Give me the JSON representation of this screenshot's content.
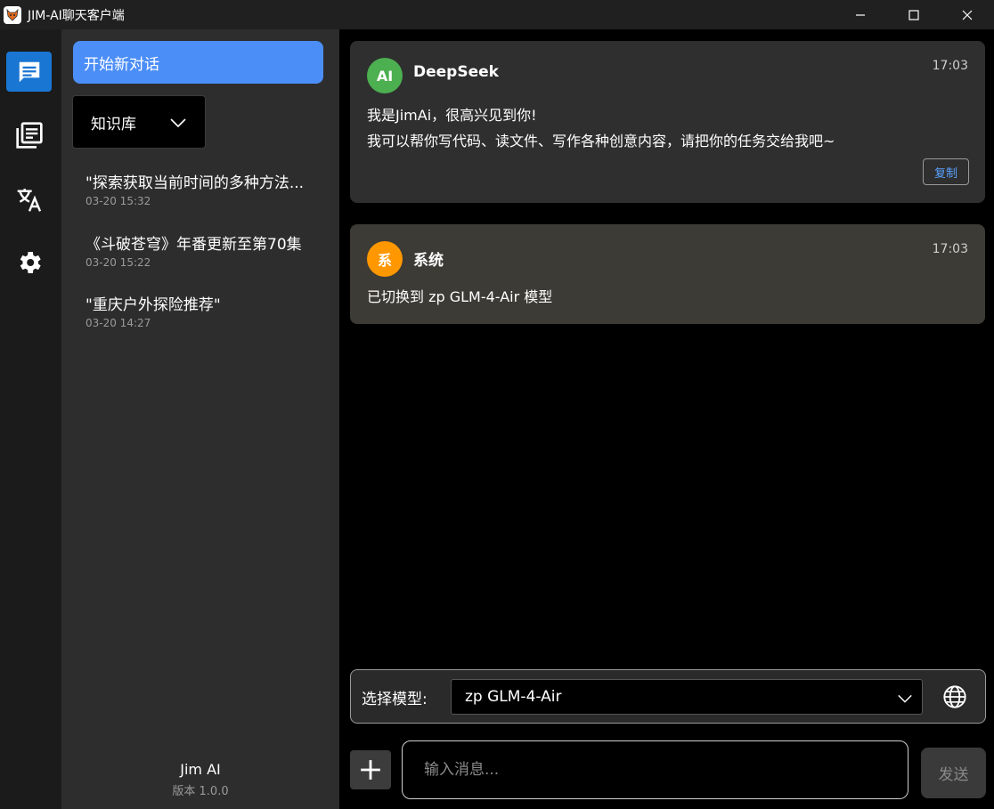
{
  "window": {
    "title": "JIM-AI聊天客户端"
  },
  "rail": {
    "icons": [
      "chat-icon",
      "library-icon",
      "translate-icon",
      "settings-icon"
    ],
    "active_color": "#1976d2"
  },
  "sidebar": {
    "new_chat_label": "开始新对话",
    "knowledge_base_label": "知识库",
    "history": [
      {
        "title": "\"探索获取当前时间的多种方法...",
        "time": "03-20 15:32"
      },
      {
        "title": "《斗破苍穹》年番更新至第70集",
        "time": "03-20 15:22"
      },
      {
        "title": "\"重庆户外探险推荐\"",
        "time": "03-20 14:27"
      }
    ],
    "footer": {
      "name": "Jim AI",
      "version": "版本 1.0.0"
    }
  },
  "messages": [
    {
      "avatar": "AI",
      "sender": "DeepSeek",
      "time": "17:03",
      "lines": [
        "我是JimAi，很高兴见到你!",
        "我可以帮你写代码、读文件、写作各种创意内容，请把你的任务交给我吧~"
      ],
      "copy_label": "复制",
      "avatar_color": "#4caf50"
    },
    {
      "avatar": "系",
      "sender": "系统",
      "time": "17:03",
      "lines": [
        "已切换到 zp GLM-4-Air 模型"
      ],
      "avatar_color": "#ff9800"
    }
  ],
  "model_bar": {
    "label": "选择模型:",
    "selected": "zp GLM-4-Air"
  },
  "composer": {
    "placeholder": "输入消息...",
    "send_label": "发送"
  }
}
